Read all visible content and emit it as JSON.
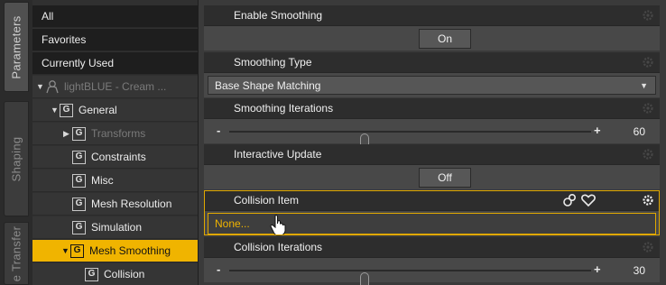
{
  "side_tabs": [
    {
      "label": "Parameters"
    },
    {
      "label": "Shaping"
    },
    {
      "label": "e Transfer"
    }
  ],
  "tree": {
    "items": [
      {
        "label": "All"
      },
      {
        "label": "Favorites"
      },
      {
        "label": "Currently Used"
      },
      {
        "label": "lightBLUE - Cream ..."
      },
      {
        "label": "General"
      },
      {
        "label": "Transforms"
      },
      {
        "label": "Constraints"
      },
      {
        "label": "Misc"
      },
      {
        "label": "Mesh Resolution"
      },
      {
        "label": "Simulation"
      },
      {
        "label": "Mesh Smoothing"
      },
      {
        "label": "Collision"
      }
    ],
    "group_icon_letter": "G"
  },
  "properties": {
    "enable_smoothing": {
      "title": "Enable Smoothing",
      "value": "On"
    },
    "smoothing_type": {
      "title": "Smoothing Type",
      "value": "Base Shape Matching"
    },
    "smoothing_iterations": {
      "title": "Smoothing Iterations",
      "value": "60",
      "minus": "-",
      "plus": "+",
      "fraction": 0.375
    },
    "interactive_update": {
      "title": "Interactive Update",
      "value": "Off"
    },
    "collision_item": {
      "title": "Collision Item",
      "value": "None..."
    },
    "collision_iterations": {
      "title": "Collision Iterations",
      "value": "30",
      "minus": "-",
      "plus": "+",
      "fraction": 0.375
    }
  },
  "colors": {
    "selected": "#f0b400",
    "highlight_border": "#e0a800"
  }
}
